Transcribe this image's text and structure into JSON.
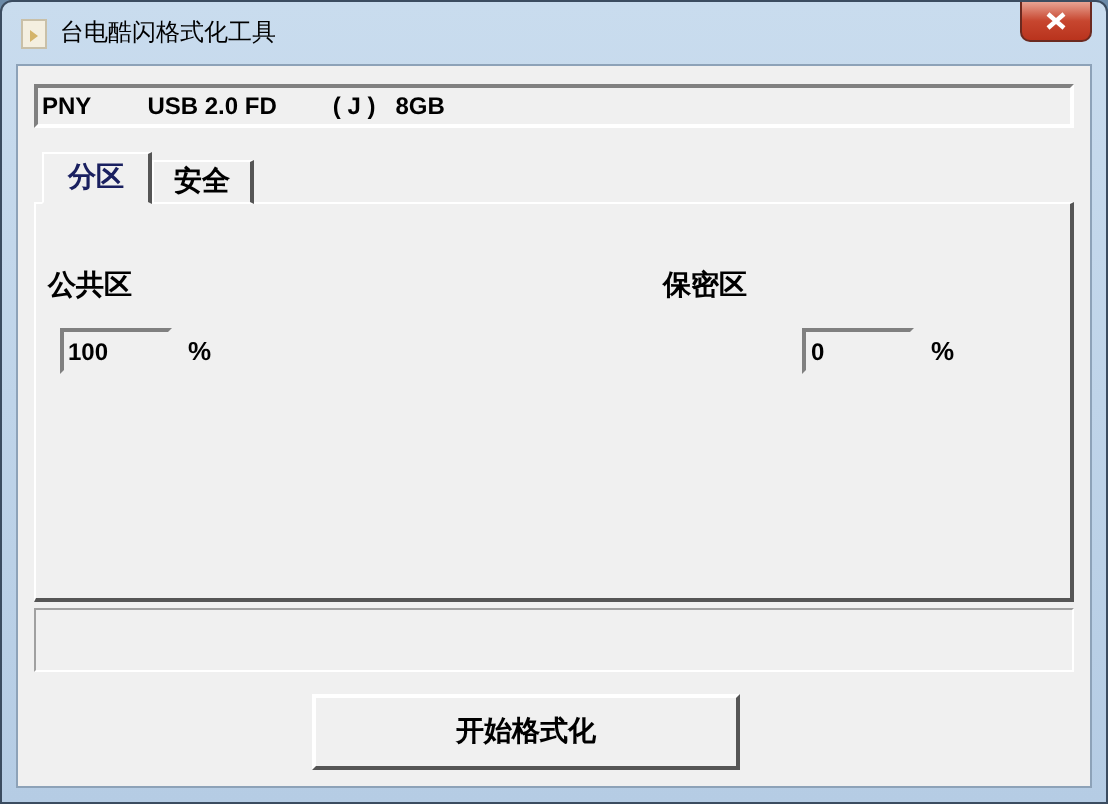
{
  "window": {
    "title": "台电酷闪格式化工具"
  },
  "device": {
    "vendor": "PNY",
    "model": "USB 2.0 FD",
    "drive": "( J )",
    "capacity": "8GB"
  },
  "tabs": [
    {
      "label": "分区",
      "selected": true
    },
    {
      "label": "安全",
      "selected": false
    }
  ],
  "partitions": [
    {
      "label": "公共区",
      "value": "100",
      "unit": "%"
    },
    {
      "label": "保密区",
      "value": "0",
      "unit": "%"
    }
  ],
  "button": "开始格式化"
}
